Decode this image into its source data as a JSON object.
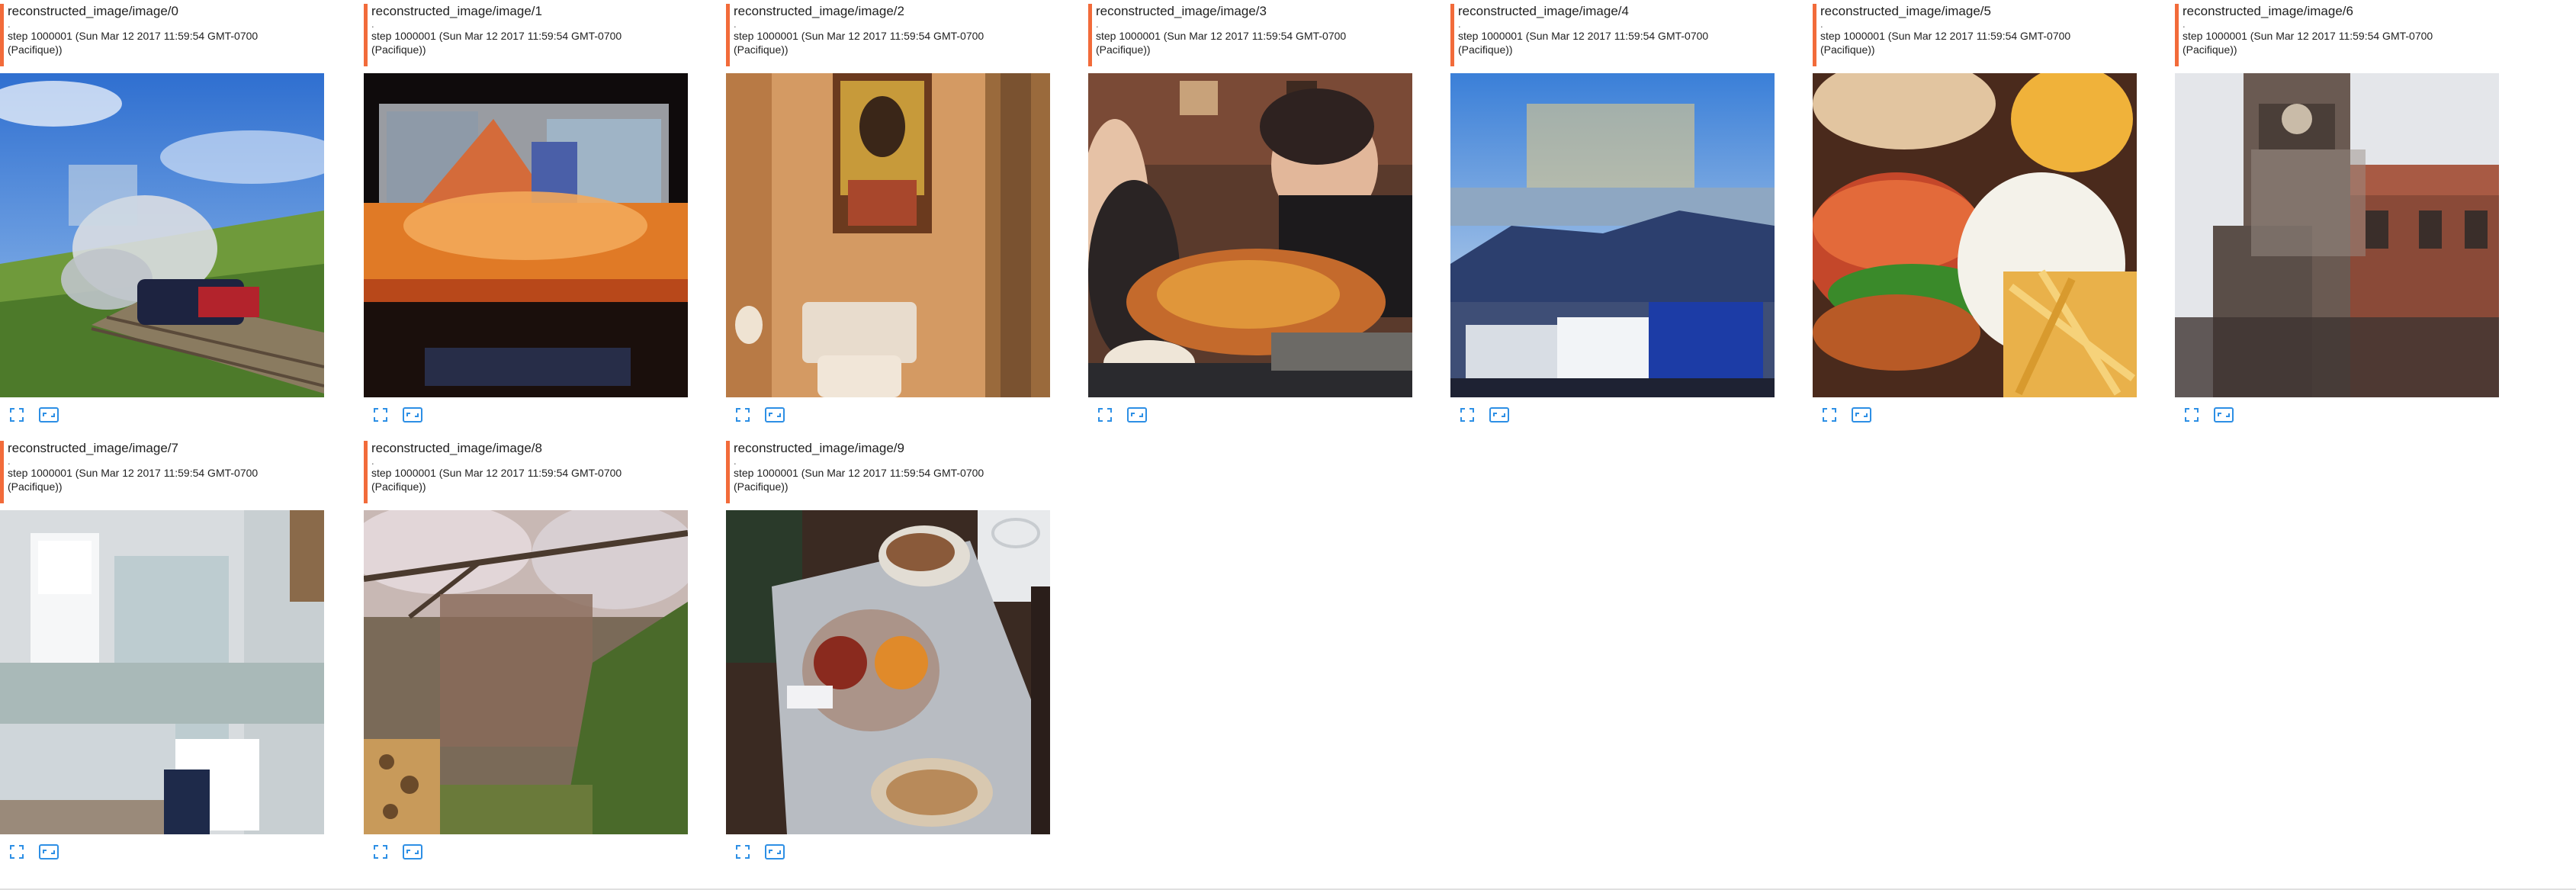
{
  "accent_color": "#f26b3a",
  "icon_color": "#2d8fe5",
  "cards": [
    {
      "title": "reconstructed_image/image/0",
      "sep": ".",
      "step": "step 1000001 (Sun Mar 12 2017 11:59:54 GMT-0700 (Pacifique))",
      "image_subject": "steam train on rails under blue sky",
      "controls": {
        "expand_icon": "fullscreen-icon",
        "fit_icon": "fit-size-icon"
      }
    },
    {
      "title": "reconstructed_image/image/1",
      "sep": ".",
      "step": "step 1000001 (Sun Mar 12 2017 11:59:54 GMT-0700 (Pacifique))",
      "image_subject": "orange lit desk in dark room",
      "controls": {
        "expand_icon": "fullscreen-icon",
        "fit_icon": "fit-size-icon"
      }
    },
    {
      "title": "reconstructed_image/image/2",
      "sep": ".",
      "step": "step 1000001 (Sun Mar 12 2017 11:59:54 GMT-0700 (Pacifique))",
      "image_subject": "bathroom toilet with framed picture",
      "controls": {
        "expand_icon": "fullscreen-icon",
        "fit_icon": "fit-size-icon"
      }
    },
    {
      "title": "reconstructed_image/image/3",
      "sep": ".",
      "step": "step 1000001 (Sun Mar 12 2017 11:59:54 GMT-0700 (Pacifique))",
      "image_subject": "people eating pizza at table",
      "controls": {
        "expand_icon": "fullscreen-icon",
        "fit_icon": "fit-size-icon"
      }
    },
    {
      "title": "reconstructed_image/image/4",
      "sep": ".",
      "step": "step 1000001 (Sun Mar 12 2017 11:59:54 GMT-0700 (Pacifique))",
      "image_subject": "trucks parked by mountains and lake",
      "controls": {
        "expand_icon": "fullscreen-icon",
        "fit_icon": "fit-size-icon"
      }
    },
    {
      "title": "reconstructed_image/image/5",
      "sep": ".",
      "step": "step 1000001 (Sun Mar 12 2017 11:59:54 GMT-0700 (Pacifique))",
      "image_subject": "burger and fries",
      "controls": {
        "expand_icon": "fullscreen-icon",
        "fit_icon": "fit-size-icon"
      }
    },
    {
      "title": "reconstructed_image/image/6",
      "sep": ".",
      "step": "step 1000001 (Sun Mar 12 2017 11:59:54 GMT-0700 (Pacifique))",
      "image_subject": "old clock tower building",
      "controls": {
        "expand_icon": "fullscreen-icon",
        "fit_icon": "fit-size-icon"
      }
    },
    {
      "title": "reconstructed_image/image/7",
      "sep": ".",
      "step": "step 1000001 (Sun Mar 12 2017 11:59:54 GMT-0700 (Pacifique))",
      "image_subject": "white bathroom with window and sink",
      "controls": {
        "expand_icon": "fullscreen-icon",
        "fit_icon": "fit-size-icon"
      }
    },
    {
      "title": "reconstructed_image/image/8",
      "sep": ".",
      "step": "step 1000001 (Sun Mar 12 2017 11:59:54 GMT-0700 (Pacifique))",
      "image_subject": "giraffe under blossoming tree",
      "controls": {
        "expand_icon": "fullscreen-icon",
        "fit_icon": "fit-size-icon"
      }
    },
    {
      "title": "reconstructed_image/image/9",
      "sep": ".",
      "step": "step 1000001 (Sun Mar 12 2017 11:59:54 GMT-0700 (Pacifique))",
      "image_subject": "food plates on table",
      "controls": {
        "expand_icon": "fullscreen-icon",
        "fit_icon": "fit-size-icon"
      }
    }
  ]
}
